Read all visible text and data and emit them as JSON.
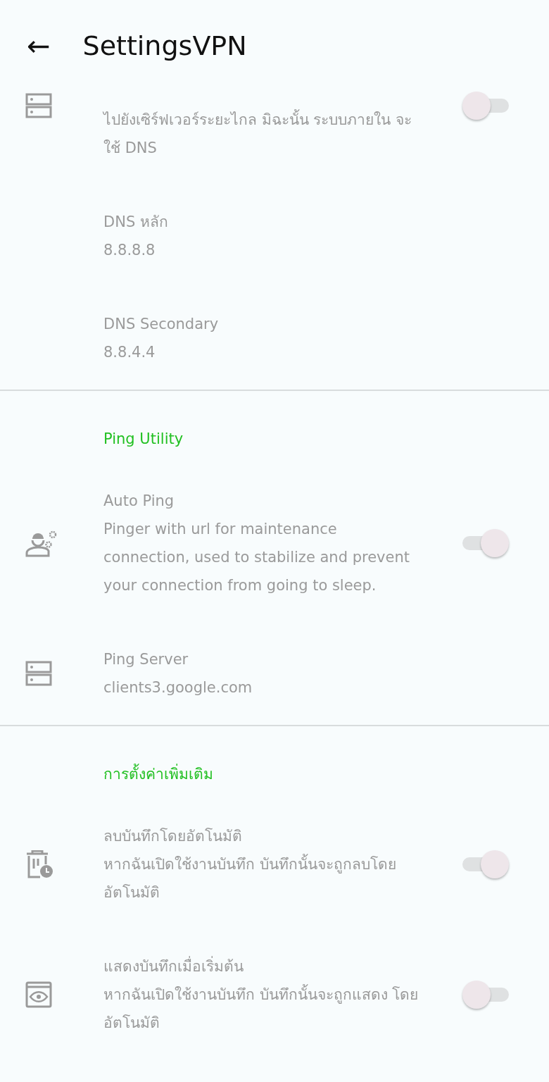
{
  "app_bar": {
    "back": "←",
    "title": "SettingsVPN"
  },
  "sections": [
    {
      "items": [
        {
          "kind": "toggle",
          "summary": "ไปยังเซิร์ฟเวอร์ระยะไกล มิฉะนั้น ระบบภายใน จะใช้ DNS",
          "on": false
        },
        {
          "kind": "text",
          "title": "DNS หลัก",
          "summary": "8.8.8.8"
        },
        {
          "kind": "text",
          "title": "DNS Secondary",
          "summary": "8.8.4.4"
        }
      ]
    },
    {
      "header": "Ping Utility",
      "items": [
        {
          "kind": "toggle",
          "title": "Auto Ping",
          "summary": "Pinger with url for maintenance connection, used to stabilize and prevent your connection from going to sleep.",
          "on": true
        },
        {
          "kind": "text",
          "title": "Ping Server",
          "summary": "clients3.google.com"
        }
      ]
    },
    {
      "header": "การตั้งค่าเพิ่มเติม",
      "items": [
        {
          "kind": "toggle",
          "title": "ลบบันทึกโดยอัตโนมัติ",
          "summary": "หากฉันเปิดใช้งานบันทึก บันทึกนั้นจะถูกลบโดย อัตโนมัติ",
          "on": true
        },
        {
          "kind": "toggle",
          "title": "แสดงบันทึกเมื่อเริ่มต้น",
          "summary": "หากฉันเปิดใช้งานบันทึก บันทึกนั้นจะถูกแสดง โดยอัตโนมัติ",
          "on": false
        }
      ]
    }
  ]
}
